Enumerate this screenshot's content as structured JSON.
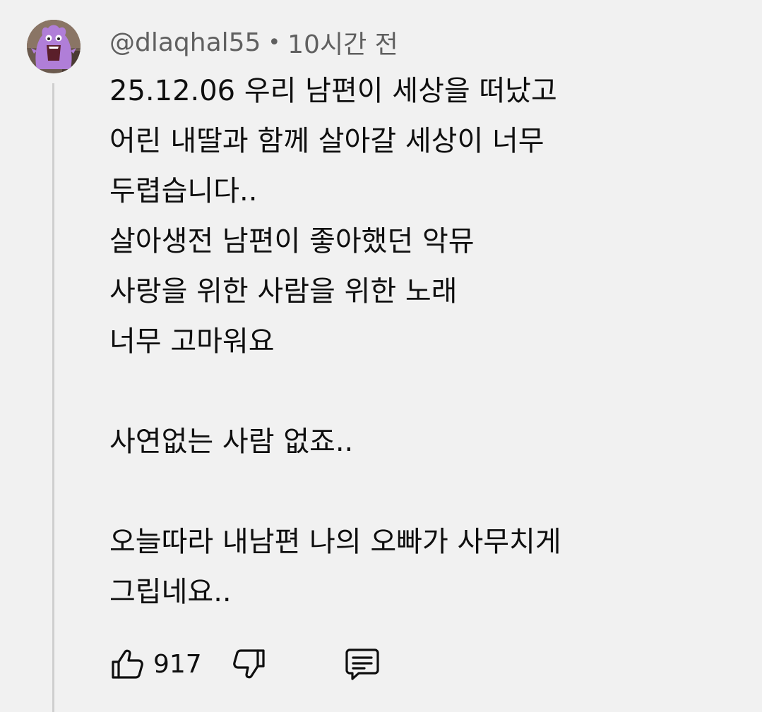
{
  "comment": {
    "author": "@dlaqhal55",
    "separator": "•",
    "time": "10시간 전",
    "lines": [
      "25.12.06 우리 남편이 세상을 떠났고",
      "어린 내딸과 함께 살아갈 세상이 너무",
      "두렵습니다..",
      "살아생전 남편이 좋아했던 악뮤",
      "사랑을 위한 사람을 위한 노래",
      "너무 고마워요",
      "",
      "사연없는 사람 없죠..",
      "",
      "오늘따라 내남편 나의 오빠가 사무치게",
      "그립네요.."
    ],
    "like_count": "917"
  },
  "icons": {
    "avatar": "purple-character-avatar",
    "like": "thumb-up-icon",
    "dislike": "thumb-down-icon",
    "reply": "comment-reply-icon"
  },
  "colors": {
    "background": "#f1f1f1",
    "text": "#0f0f0f",
    "meta_text": "#606060",
    "thread_line": "#cfcfcf",
    "avatar_purple": "#b07ed8"
  }
}
